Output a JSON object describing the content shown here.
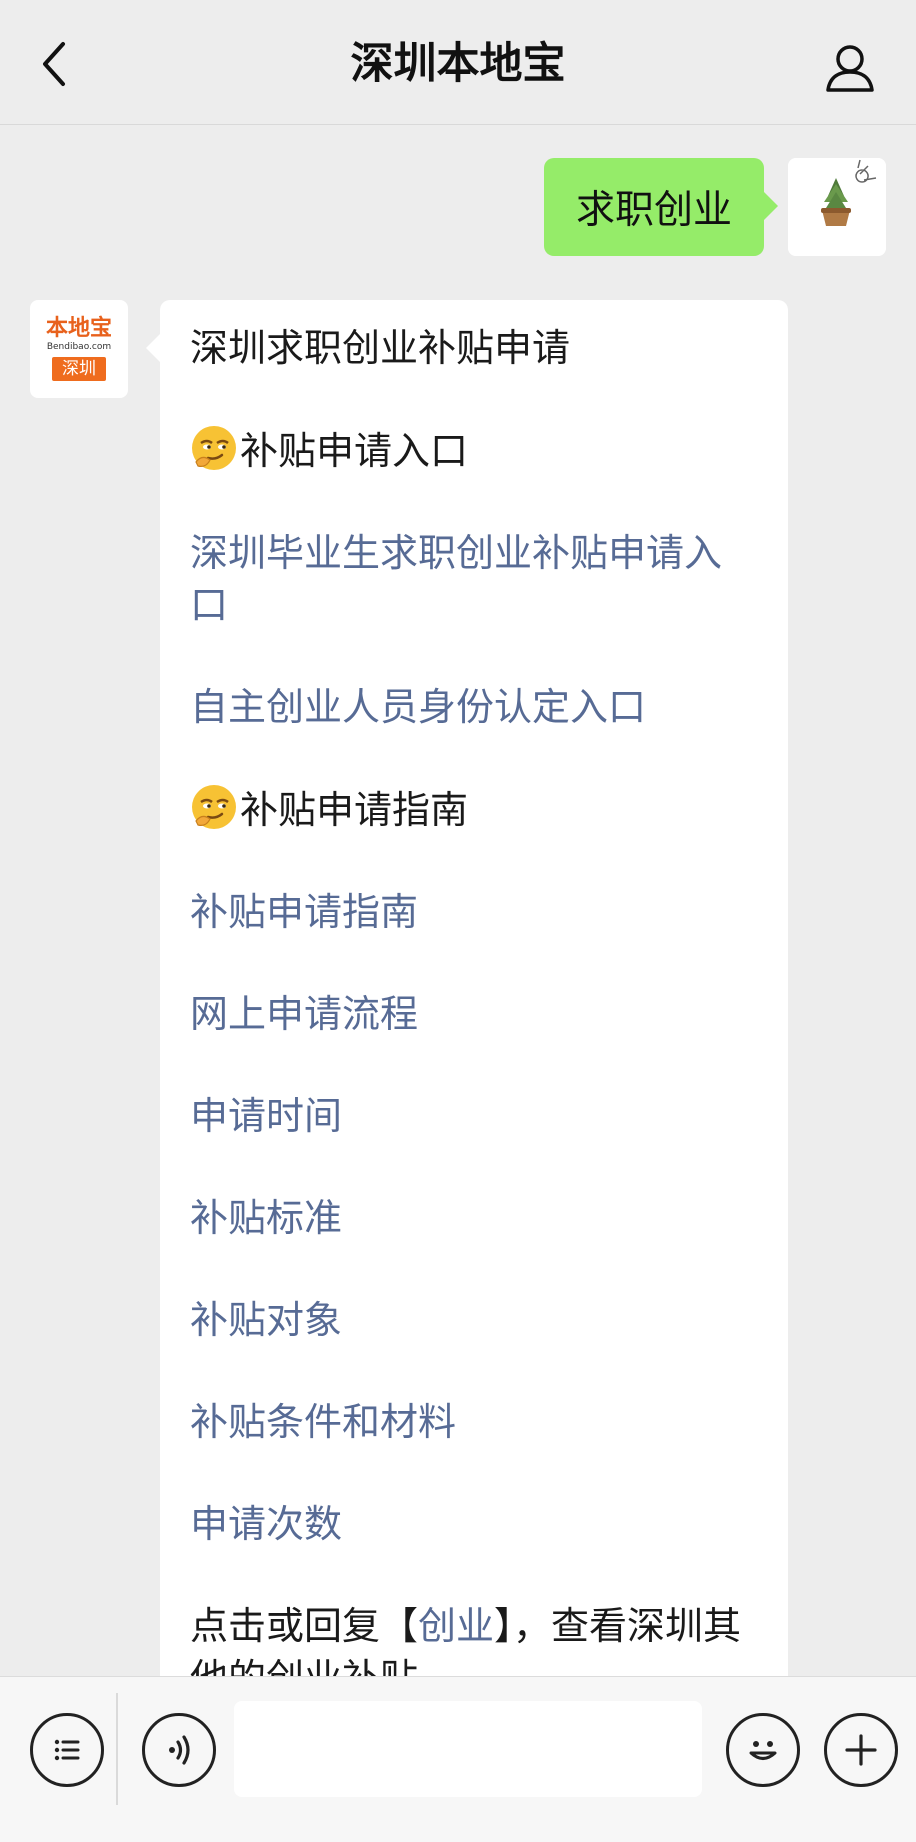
{
  "header": {
    "title": "深圳本地宝"
  },
  "messages": {
    "sent": {
      "text": "求职创业"
    },
    "received": {
      "avatar": {
        "logo_text": "本地宝",
        "logo_sub": "Bendibao.com",
        "city": "深圳"
      },
      "lines": [
        {
          "text": "深圳求职创业补贴申请",
          "type": "text"
        },
        {
          "text": "补贴申请入口",
          "type": "heading",
          "emoji": "smirk-face"
        },
        {
          "text": "深圳毕业生求职创业补贴申请入口",
          "type": "link"
        },
        {
          "text": "自主创业人员身份认定入口",
          "type": "link"
        },
        {
          "text": "补贴申请指南",
          "type": "heading",
          "emoji": "smirk-face"
        },
        {
          "text": "补贴申请指南",
          "type": "link"
        },
        {
          "text": "网上申请流程",
          "type": "link"
        },
        {
          "text": "申请时间",
          "type": "link"
        },
        {
          "text": "补贴标准",
          "type": "link"
        },
        {
          "text": "补贴对象",
          "type": "link"
        },
        {
          "text": "补贴条件和材料",
          "type": "link"
        },
        {
          "text": "申请次数",
          "type": "link"
        }
      ],
      "footer_line": {
        "before": "点击或回复【",
        "link": "创业",
        "after": "】，查看深圳其他的创业补贴"
      }
    }
  },
  "footer": {
    "icons": [
      "menu-icon",
      "voice-icon",
      "emoji-icon",
      "plus-icon"
    ]
  },
  "colors": {
    "sent_bubble": "#95ec69",
    "link": "#576b95",
    "background": "#ededed"
  }
}
